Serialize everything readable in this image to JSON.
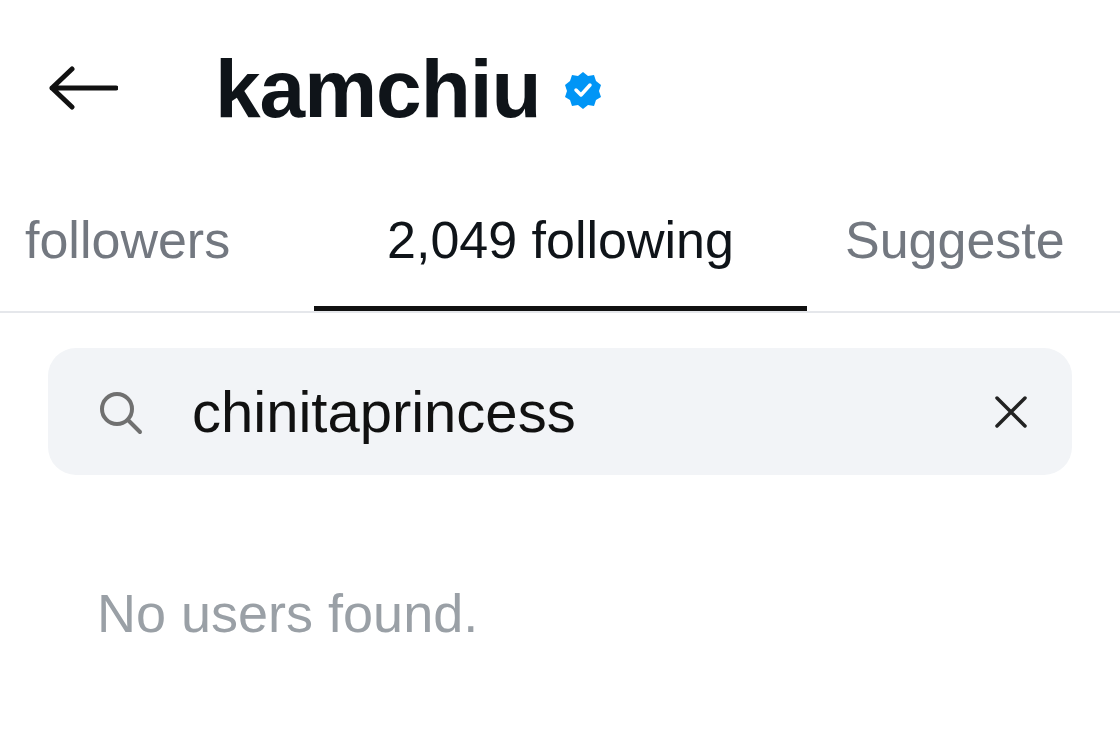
{
  "header": {
    "title": "kamchiu",
    "verified": true
  },
  "tabs": [
    {
      "label": "followers",
      "selected": false
    },
    {
      "label": "2,049 following",
      "selected": true
    },
    {
      "label": "Suggeste",
      "selected": false
    }
  ],
  "search": {
    "value": "chinitaprincess"
  },
  "empty_message": "No users found."
}
